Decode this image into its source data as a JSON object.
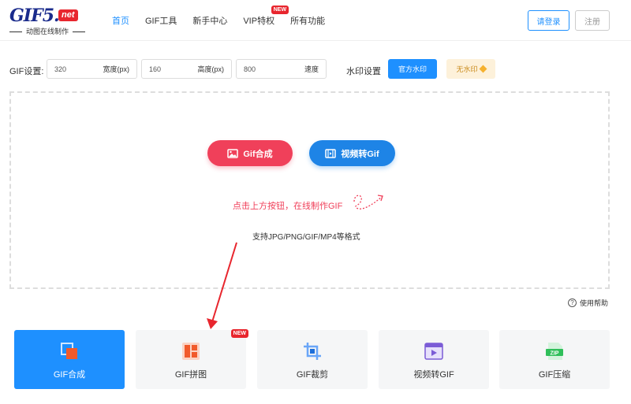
{
  "header": {
    "logo_main": "GIF5.",
    "logo_net": "net",
    "logo_sub": "动图在线制作",
    "nav": [
      {
        "label": "首页",
        "active": true
      },
      {
        "label": "GIF工具"
      },
      {
        "label": "新手中心"
      },
      {
        "label": "VIP特权",
        "badge": "NEW"
      },
      {
        "label": "所有功能"
      }
    ],
    "login_label": "请登录",
    "register_label": "注册"
  },
  "settings": {
    "label": "GIF设置:",
    "width": {
      "value": "320",
      "unit": "宽度(px)"
    },
    "height": {
      "value": "160",
      "unit": "高度(px)"
    },
    "speed": {
      "value": "800",
      "unit": "速度"
    },
    "watermark_label": "水印设置",
    "watermark_official": "官方水印",
    "watermark_none": "无水印"
  },
  "drop": {
    "gif_make_label": "Gif合成",
    "video_to_gif_label": "视频转Gif",
    "hint": "点击上方按钮，在线制作GIF",
    "formats": "支持JPG/PNG/GIF/MP4等格式"
  },
  "help_label": "使用帮助",
  "tools": [
    {
      "label": "GIF合成",
      "icon": "merge-icon",
      "active": true
    },
    {
      "label": "GIF拼图",
      "icon": "collage-icon",
      "badge": "NEW"
    },
    {
      "label": "GIF裁剪",
      "icon": "crop-icon"
    },
    {
      "label": "视频转GIF",
      "icon": "video-icon"
    },
    {
      "label": "GIF压缩",
      "icon": "zip-icon"
    }
  ],
  "colors": {
    "primary": "#1e90ff",
    "accent_red": "#f0405a",
    "badge_red": "#e8262e"
  }
}
